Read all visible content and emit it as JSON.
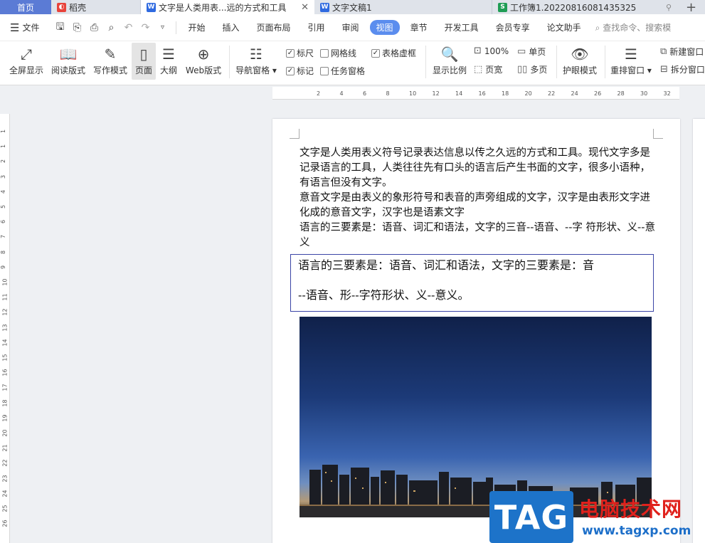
{
  "tabs": {
    "home": "首页",
    "daoke": "稻壳",
    "doc_active": "文字是人类用表...远的方式和工具",
    "doc2": "文字文稿1",
    "sheet": "工作簿1.20220816081435325",
    "add": "+"
  },
  "menubar": {
    "file": "文件",
    "items": [
      "开始",
      "插入",
      "页面布局",
      "引用",
      "审阅",
      "视图",
      "章节",
      "开发工具",
      "会员专享",
      "论文助手"
    ],
    "active": "视图",
    "search": "查找命令、搜索模"
  },
  "ribbon": {
    "fullscreen": "全屏显示",
    "reading": "阅读版式",
    "writing": "写作模式",
    "page": "页面",
    "outline": "大纲",
    "web": "Web版式",
    "nav_pane": "导航窗格",
    "ruler": "标尺",
    "gridlines": "网格线",
    "table_grid": "表格虚框",
    "marks": "标记",
    "task_pane": "任务窗格",
    "zoom": "显示比例",
    "zoom_100": "100%",
    "page_width": "页宽",
    "single_page": "单页",
    "multi_page": "多页",
    "eye_mode": "护眼模式",
    "rearrange": "重排窗口",
    "new_window": "新建窗口",
    "split_window": "拆分窗口",
    "checks": {
      "ruler": true,
      "gridlines": false,
      "table_grid": true,
      "marks": true,
      "task_pane": false
    }
  },
  "ruler": {
    "top_ticks": [
      "2",
      "4",
      "6",
      "8",
      "10",
      "12",
      "14",
      "16",
      "18",
      "20",
      "22",
      "24",
      "26",
      "28",
      "30",
      "32"
    ],
    "left_ticks": [
      "1",
      "1",
      "2",
      "3",
      "4",
      "5",
      "6",
      "7",
      "8",
      "9",
      "10",
      "11",
      "12",
      "13",
      "14",
      "15",
      "16",
      "17",
      "18",
      "19",
      "20",
      "21",
      "22",
      "23",
      "24",
      "25",
      "26"
    ]
  },
  "document": {
    "paragraphs": [
      "文字是人类用表义符号记录表达信息以传之久远的方式和工具。现代文字多是记录语言的工具，人类往往先有口头的语言后产生书面的文字，很多小语种，有语言但没有文字。",
      "意音文字是由表义的象形符号和表音的声旁组成的文字，汉字是由表形文字进化成的意音文字，汉字也是语素文字",
      "语言的三要素是：语音、词汇和语法，文字的三音--语音、--字  符形状、义--意义"
    ],
    "textbox_line1": "语言的三要素是：语音、词汇和语法，文字的三要素是：音",
    "textbox_line2": "--语音、形--字符形状、义--意义。"
  },
  "watermark": {
    "tag": "TAG",
    "cn": "电脑技术网",
    "url": "www.tagxp.com"
  }
}
